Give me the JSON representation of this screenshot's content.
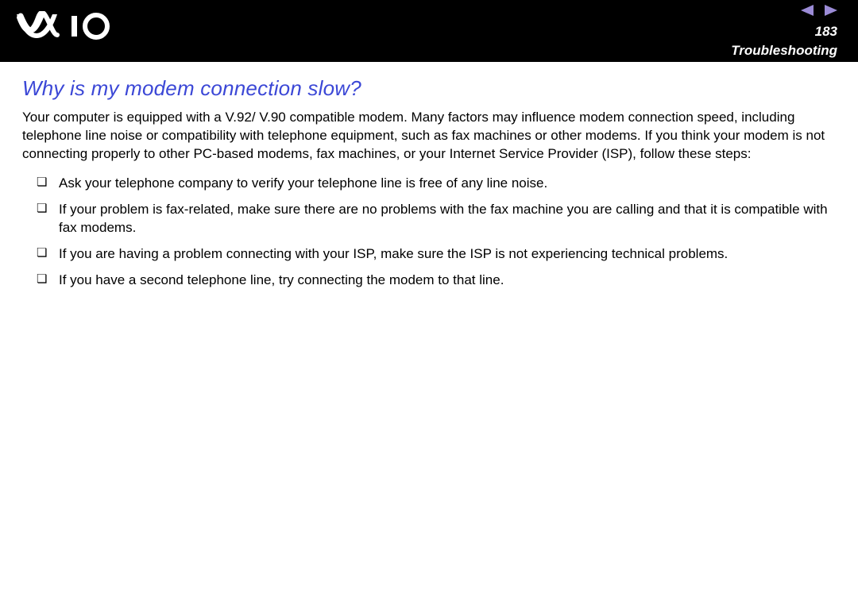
{
  "header": {
    "page_number": "183",
    "section": "Troubleshooting"
  },
  "content": {
    "heading": "Why is my modem connection slow?",
    "intro": "Your computer is equipped with a V.92/ V.90 compatible modem. Many factors may influence modem connection speed, including telephone line noise or compatibility with telephone equipment, such as fax machines or other modems. If you think your modem is not connecting properly to other PC-based modems, fax machines, or your Internet Service Provider (ISP), follow these steps:",
    "bullets": [
      "Ask your telephone company to verify your telephone line is free of any line noise.",
      "If your problem is fax-related, make sure there are no problems with the fax machine you are calling and that it is compatible with fax modems.",
      "If you are having a problem connecting with your ISP, make sure the ISP is not experiencing technical problems.",
      "If you have a second telephone line, try connecting the modem to that line."
    ]
  }
}
